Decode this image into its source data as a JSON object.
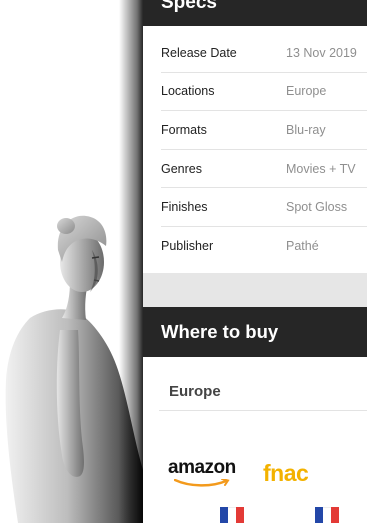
{
  "specs": {
    "title": "Specs",
    "rows": [
      {
        "label": "Release Date",
        "value": "13 Nov 2019"
      },
      {
        "label": "Locations",
        "value": "Europe"
      },
      {
        "label": "Formats",
        "value": "Blu-ray"
      },
      {
        "label": "Genres",
        "value": "Movies + TV"
      },
      {
        "label": "Finishes",
        "value": "Spot Gloss"
      },
      {
        "label": "Publisher",
        "value": "Pathé"
      }
    ]
  },
  "where_to_buy": {
    "title": "Where to buy",
    "region": "Europe",
    "retailers": [
      {
        "name": "amazon",
        "flag": "france-flag-icon"
      },
      {
        "name": "fnac",
        "flag": "france-flag-icon"
      }
    ]
  },
  "colors": {
    "header_bg": "#262626",
    "panel_bg": "#e6e6e6",
    "amazon_arrow": "#f39a1c",
    "fnac_yellow": "#f3b200"
  }
}
